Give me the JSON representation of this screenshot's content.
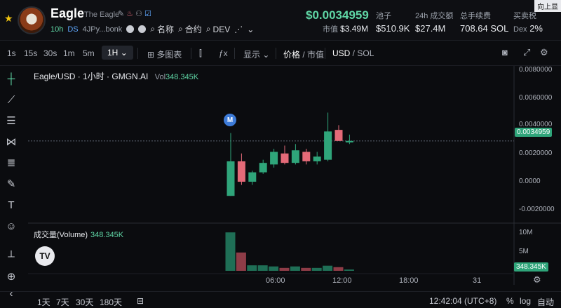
{
  "token": {
    "name": "Eagle",
    "full_name": "The Eagle",
    "age": "10h",
    "ds_label": "DS",
    "address": "4JPy...bonk",
    "links": [
      "名称",
      "合约",
      "DEV"
    ]
  },
  "stats": {
    "price": "$0.0034959",
    "mcap_label": "市值",
    "mcap_value": "$3.49M",
    "pool_label": "池子",
    "pool_value": "$510.9K",
    "volume24_label": "24h 成交额",
    "volume24_value": "$27.4M",
    "fee_label": "总手续费",
    "fee_value": "708.64 SOL",
    "trade_label": "买卖税",
    "trade_sub": "Dex",
    "trade_value": "2%",
    "corner": "向上显"
  },
  "toolbar": {
    "timeframes": [
      "1s",
      "15s",
      "30s",
      "1m",
      "5m"
    ],
    "active_timeframe": "1H",
    "indicators_label": "多图表",
    "display_label": "显示",
    "price_label": "价格",
    "mcap_toggle": "市值",
    "currency_usd": "USD",
    "currency_sol": "SOL"
  },
  "legend": {
    "symbol": "Eagle/USD · 1小时 · GMGN.AI",
    "vol_label": "Vol",
    "vol_value": "348.345K",
    "volume_title": "成交量(Volume)",
    "volume_value": "348.345K"
  },
  "markers": {
    "m": "M",
    "tv": "TV"
  },
  "chart_data": {
    "type": "candlestick",
    "title": "Eagle/USD · 1小时 · GMGN.AI",
    "y_axis_ticks": [
      "0.0080000",
      "0.0060000",
      "0.0040000",
      "0.0020000",
      "0.0000",
      "-0.0020000"
    ],
    "ylim": [
      -0.002,
      0.008
    ],
    "current_price": "0.0034959",
    "x_axis_ticks": [
      "06:00",
      "12:00",
      "18:00",
      "31"
    ],
    "candles": [
      {
        "o": 0.0,
        "h": 0.004,
        "l": 0.0,
        "c": 0.0022
      },
      {
        "o": 0.0022,
        "h": 0.0027,
        "l": 0.0007,
        "c": 0.0009
      },
      {
        "o": 0.0009,
        "h": 0.0016,
        "l": 0.0007,
        "c": 0.0015
      },
      {
        "o": 0.0015,
        "h": 0.0023,
        "l": 0.0014,
        "c": 0.0021
      },
      {
        "o": 0.002,
        "h": 0.003,
        "l": 0.0018,
        "c": 0.0028
      },
      {
        "o": 0.0027,
        "h": 0.0032,
        "l": 0.002,
        "c": 0.0021
      },
      {
        "o": 0.0021,
        "h": 0.0033,
        "l": 0.002,
        "c": 0.0029
      },
      {
        "o": 0.0028,
        "h": 0.003,
        "l": 0.002,
        "c": 0.0022
      },
      {
        "o": 0.0022,
        "h": 0.0028,
        "l": 0.002,
        "c": 0.0025
      },
      {
        "o": 0.0023,
        "h": 0.0053,
        "l": 0.0022,
        "c": 0.0041
      },
      {
        "o": 0.0042,
        "h": 0.0045,
        "l": 0.0035,
        "c": 0.0035
      },
      {
        "o": 0.0034,
        "h": 0.0039,
        "l": 0.0033,
        "c": 0.0035
      }
    ],
    "volume_ticks": [
      "10M",
      "5M"
    ],
    "volume_last": "348.345K",
    "volumes": [
      10.5,
      5.0,
      1.5,
      1.5,
      1.2,
      0.8,
      1.2,
      0.8,
      0.8,
      1.4,
      1.0,
      0.35
    ],
    "volume_directions": [
      "up",
      "down",
      "up",
      "up",
      "up",
      "down",
      "up",
      "down",
      "up",
      "up",
      "down",
      "up"
    ]
  },
  "bottom": {
    "ranges": [
      "1天",
      "7天",
      "30天",
      "180天"
    ],
    "time": "12:42:04 (UTC+8)",
    "pct": "%",
    "log": "log",
    "auto": "自动"
  },
  "colors": {
    "up": "#2fa57a",
    "down": "#e46a78",
    "accent": "#5fd6a5"
  }
}
